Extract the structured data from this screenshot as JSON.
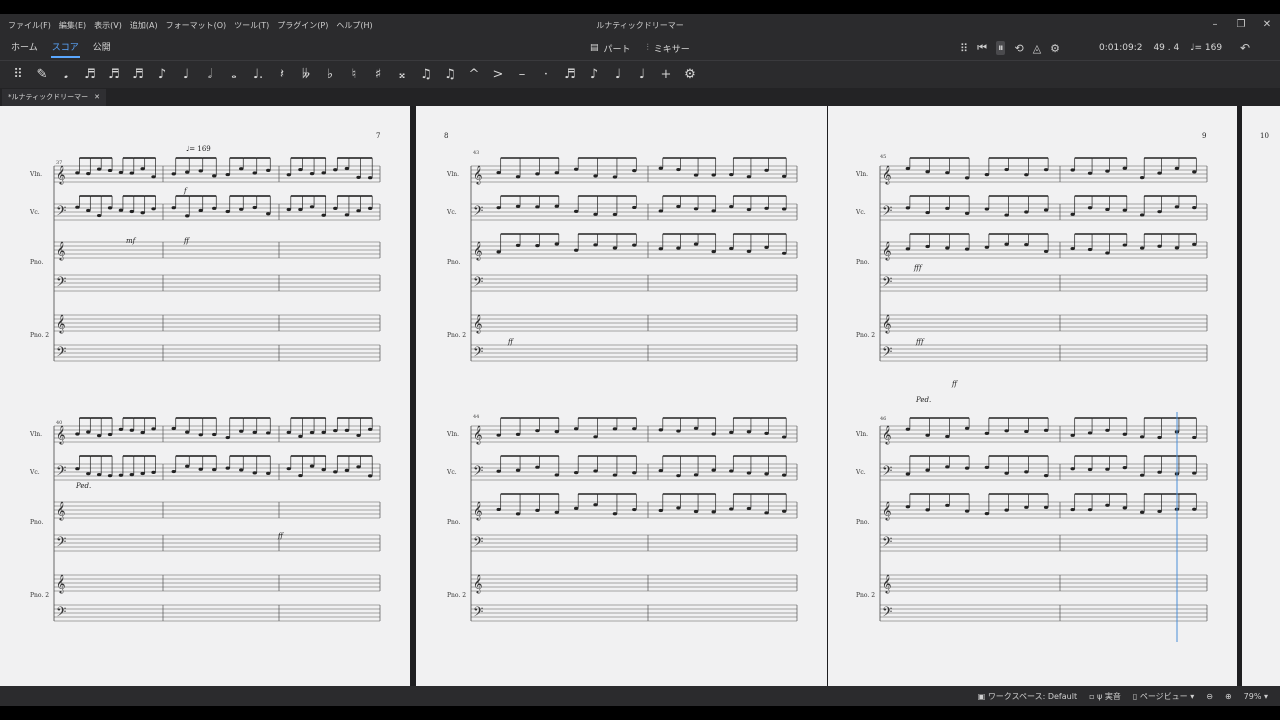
{
  "window": {
    "title": "ルナティックドリーマー",
    "menu": [
      "ファイル(F)",
      "編集(E)",
      "表示(V)",
      "追加(A)",
      "フォーマット(O)",
      "ツール(T)",
      "プラグイン(P)",
      "ヘルプ(H)"
    ]
  },
  "nav": {
    "tabs": [
      "ホーム",
      "スコア",
      "公開"
    ],
    "active_tab": "スコア",
    "parts_label": "パート",
    "mixer_label": "ミキサー"
  },
  "playback": {
    "time": "0:01:09:2",
    "position": "49 . 4",
    "tempo": "♩= 169"
  },
  "document_tab": "*ルナティックドリーマー",
  "score": {
    "page_numbers": [
      "7",
      "8",
      "9",
      "10"
    ],
    "instruments": [
      "Vln.",
      "Vc.",
      "Pno.",
      "Pno. 2"
    ],
    "tempo_marking": "♩= 169",
    "measure_numbers": [
      "37",
      "40",
      "43",
      "44",
      "45",
      "46"
    ],
    "dynamics": [
      "f",
      "mf",
      "ff",
      "f",
      "ff",
      "ff",
      "fff",
      "fff",
      "ff"
    ],
    "pedal": "Ped."
  },
  "status": {
    "workspace": "ワークスペース: Default",
    "concert": "実音",
    "view_mode": "ページビュー",
    "zoom": "79%"
  },
  "colors": {
    "accent": "#5aa7ff",
    "chrome": "#2b2b2d",
    "page": "#f1f1f2",
    "playhead": "#4a8fd8"
  }
}
